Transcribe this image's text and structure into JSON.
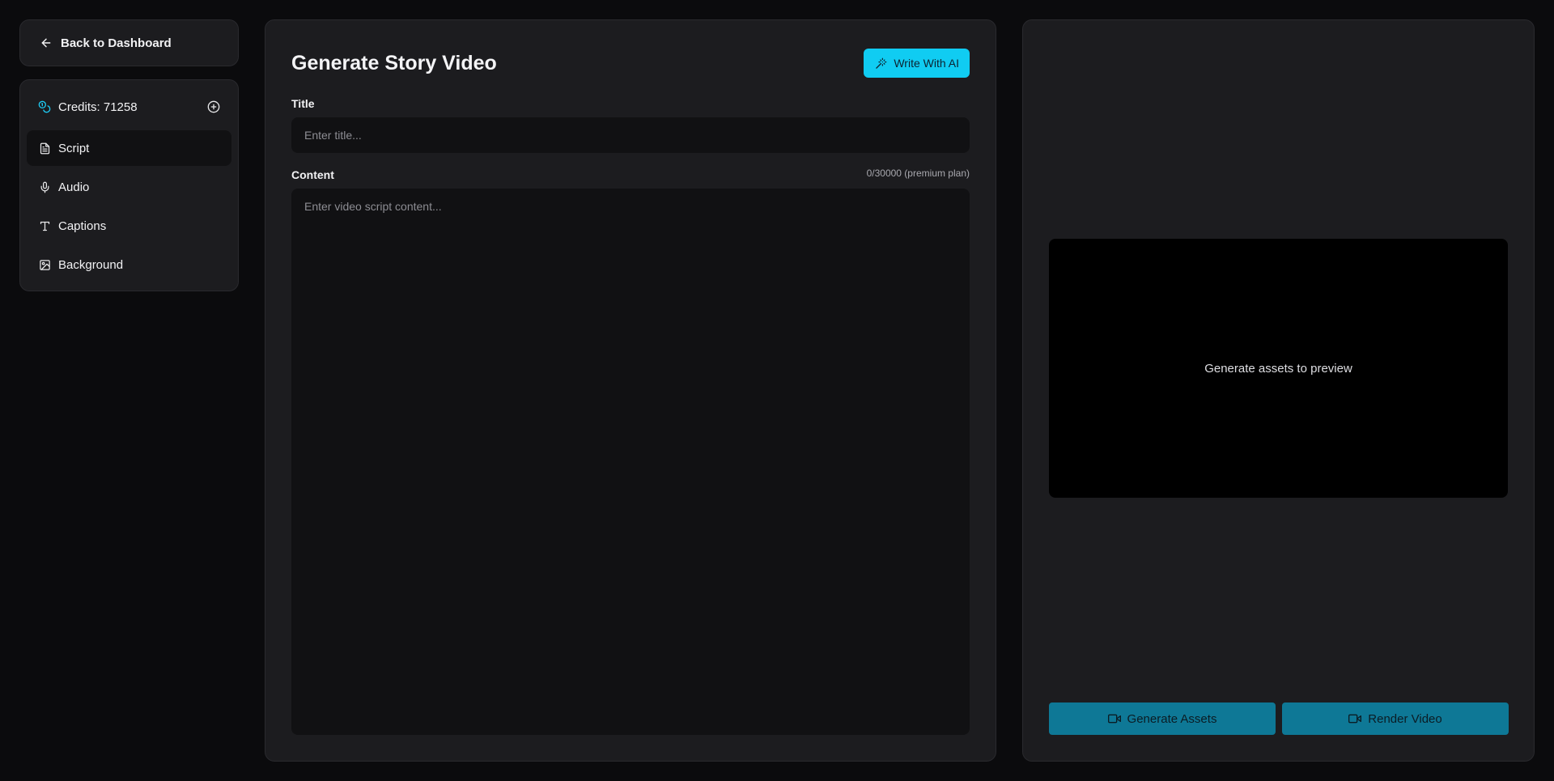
{
  "nav": {
    "back_label": "Back to Dashboard",
    "credits_label": "Credits: 71258",
    "items": [
      {
        "label": "Script",
        "icon": "file-text-icon",
        "active": true
      },
      {
        "label": "Audio",
        "icon": "mic-icon",
        "active": false
      },
      {
        "label": "Captions",
        "icon": "type-icon",
        "active": false
      },
      {
        "label": "Background",
        "icon": "image-icon",
        "active": false
      }
    ]
  },
  "editor": {
    "title": "Generate Story Video",
    "ai_button_label": "Write With AI",
    "title_label": "Title",
    "title_placeholder": "Enter title...",
    "title_value": "",
    "content_label": "Content",
    "content_counter": "0/30000 (premium plan)",
    "content_placeholder": "Enter video script content...",
    "content_value": ""
  },
  "preview": {
    "empty_text": "Generate assets to preview",
    "generate_assets_label": "Generate Assets",
    "render_video_label": "Render Video"
  },
  "colors": {
    "accent": "#10ccf2",
    "action": "#0e7896",
    "credits_icon": "#1ec8f0"
  }
}
